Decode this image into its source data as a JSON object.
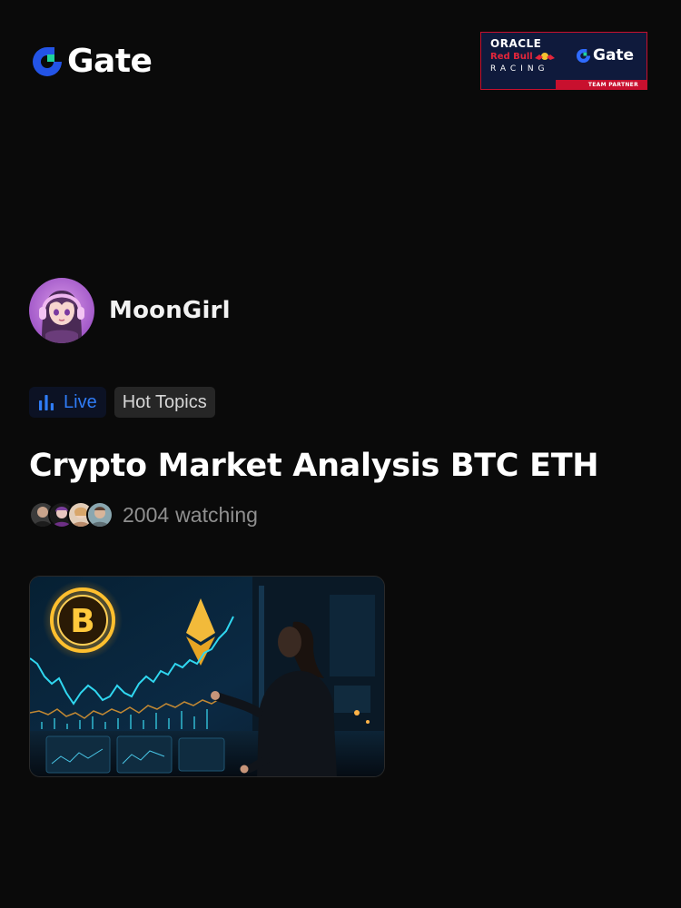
{
  "header": {
    "logo_text": "Gate",
    "logo_icon": "gate-logo-icon",
    "accent_color": "#2354e6",
    "partner_banner": {
      "line1": "ORACLE",
      "line2": "Red Bull",
      "line3": "RACING",
      "gate_text": "Gate",
      "strip_text": "TEAM PARTNER"
    }
  },
  "host": {
    "name": "MoonGirl",
    "avatar_icon": "anime-girl-headphones-avatar"
  },
  "tags": {
    "live_label": "Live",
    "live_icon": "bar-chart-icon",
    "live_color": "#2f7cf6",
    "topic_label": "Hot Topics"
  },
  "stream": {
    "title": "Crypto Market Analysis BTC ETH",
    "watch_count": "2004",
    "watch_suffix": "watching",
    "thumbnail_icon": "crypto-analysis-thumbnail"
  }
}
